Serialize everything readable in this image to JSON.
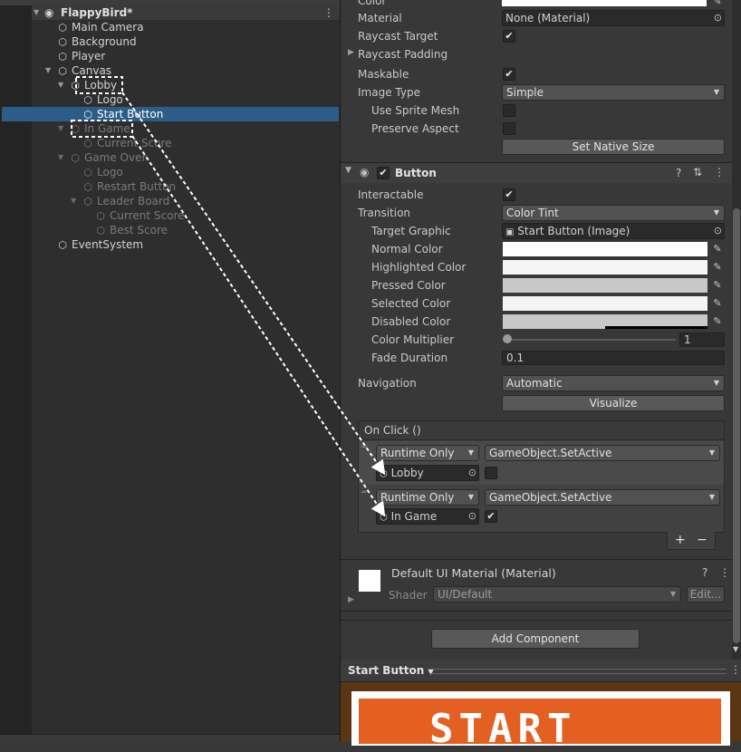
{
  "hierarchy": {
    "scene_name": "FlappyBird*",
    "items": [
      {
        "label": "Main Camera"
      },
      {
        "label": "Background"
      },
      {
        "label": "Player"
      },
      {
        "label": "Canvas"
      },
      {
        "label": "Lobby"
      },
      {
        "label": "Logo"
      },
      {
        "label": "Start Button"
      },
      {
        "label": "In Game"
      },
      {
        "label": "Current Score"
      },
      {
        "label": "Game Over"
      },
      {
        "label": "Logo"
      },
      {
        "label": "Restart Button"
      },
      {
        "label": "Leader Board"
      },
      {
        "label": "Current Score"
      },
      {
        "label": "Best Score"
      },
      {
        "label": "EventSystem"
      }
    ]
  },
  "image": {
    "color_label": "Color",
    "material_label": "Material",
    "material_value": "None (Material)",
    "raycast_target_label": "Raycast Target",
    "raycast_target_checked": true,
    "raycast_padding_label": "Raycast Padding",
    "maskable_label": "Maskable",
    "maskable_checked": true,
    "image_type_label": "Image Type",
    "image_type_value": "Simple",
    "use_sprite_mesh_label": "Use Sprite Mesh",
    "preserve_aspect_label": "Preserve Aspect",
    "set_native_size": "Set Native Size"
  },
  "button": {
    "title": "Button",
    "interactable_label": "Interactable",
    "interactable_checked": true,
    "transition_label": "Transition",
    "transition_value": "Color Tint",
    "target_graphic_label": "Target Graphic",
    "target_graphic_value": "Start Button (Image)",
    "normal_color_label": "Normal Color",
    "highlighted_color_label": "Highlighted Color",
    "pressed_color_label": "Pressed Color",
    "selected_color_label": "Selected Color",
    "disabled_color_label": "Disabled Color",
    "color_multiplier_label": "Color Multiplier",
    "color_multiplier_value": "1",
    "fade_duration_label": "Fade Duration",
    "fade_duration_value": "0.1",
    "navigation_label": "Navigation",
    "navigation_value": "Automatic",
    "visualize": "Visualize",
    "colors": {
      "normal": "#ffffff",
      "highlighted": "#f5f5f5",
      "pressed": "#c8c8c8",
      "selected": "#f5f5f5",
      "disabled": "#c8c8c8"
    }
  },
  "onclick": {
    "title": "On Click ()",
    "entries": [
      {
        "mode": "Runtime Only",
        "function": "GameObject.SetActive",
        "object": "Lobby",
        "checked": false
      },
      {
        "mode": "Runtime Only",
        "function": "GameObject.SetActive",
        "object": "In Game",
        "checked": true
      }
    ],
    "add": "+",
    "remove": "−"
  },
  "material": {
    "title": "Default UI Material (Material)",
    "shader_label": "Shader",
    "shader_value": "UI/Default",
    "edit": "Edit..."
  },
  "add_component": "Add Component",
  "preview": {
    "title": "Start Button",
    "art_text": "START"
  }
}
